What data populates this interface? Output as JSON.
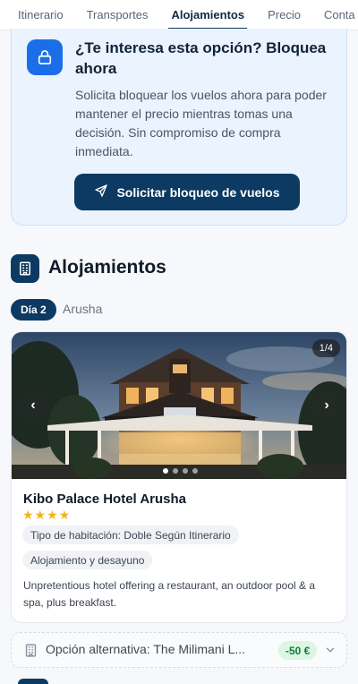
{
  "tabs": [
    {
      "label": "Itinerario"
    },
    {
      "label": "Transportes"
    },
    {
      "label": "Alojamientos",
      "active": true
    },
    {
      "label": "Precio"
    },
    {
      "label": "Conta"
    }
  ],
  "hold": {
    "icon": "lock-icon",
    "title": "¿Te interesa esta opción? Bloquea ahora",
    "text": "Solicita bloquear los vuelos ahora para poder mantener el precio mientras tomas una decisión. Sin compromiso de compra inmediata.",
    "button_label": "Solicitar bloqueo de vuelos",
    "button_icon": "send-icon"
  },
  "section": {
    "icon": "building-icon",
    "title": "Alojamientos"
  },
  "day": {
    "badge": "Día 2",
    "city": "Arusha"
  },
  "hotel": {
    "photo_counter": "1/4",
    "photo_index": 1,
    "photo_total": 4,
    "name": "Kibo Palace Hotel Arusha",
    "stars_text": "★★★★",
    "rating_stars": 4,
    "room_chip": "Tipo de habitación: Doble Según Itinerario",
    "board_chip": "Alojamiento y desayuno",
    "description": "Unpretentious hotel offering a restaurant, an outdoor pool & a spa, plus breakfast.",
    "prev_icon": "chevron-left-icon",
    "next_icon": "chevron-right-icon"
  },
  "alternative": {
    "icon": "building-icon",
    "label": "Opción alternativa: The Milimani L...",
    "price": "-50 €",
    "chevron_icon": "chevron-down-icon"
  },
  "colors": {
    "brand": "#0c3a62",
    "accent": "#1a6fe8",
    "star": "#f2b41c",
    "savings": "#177a3b"
  }
}
